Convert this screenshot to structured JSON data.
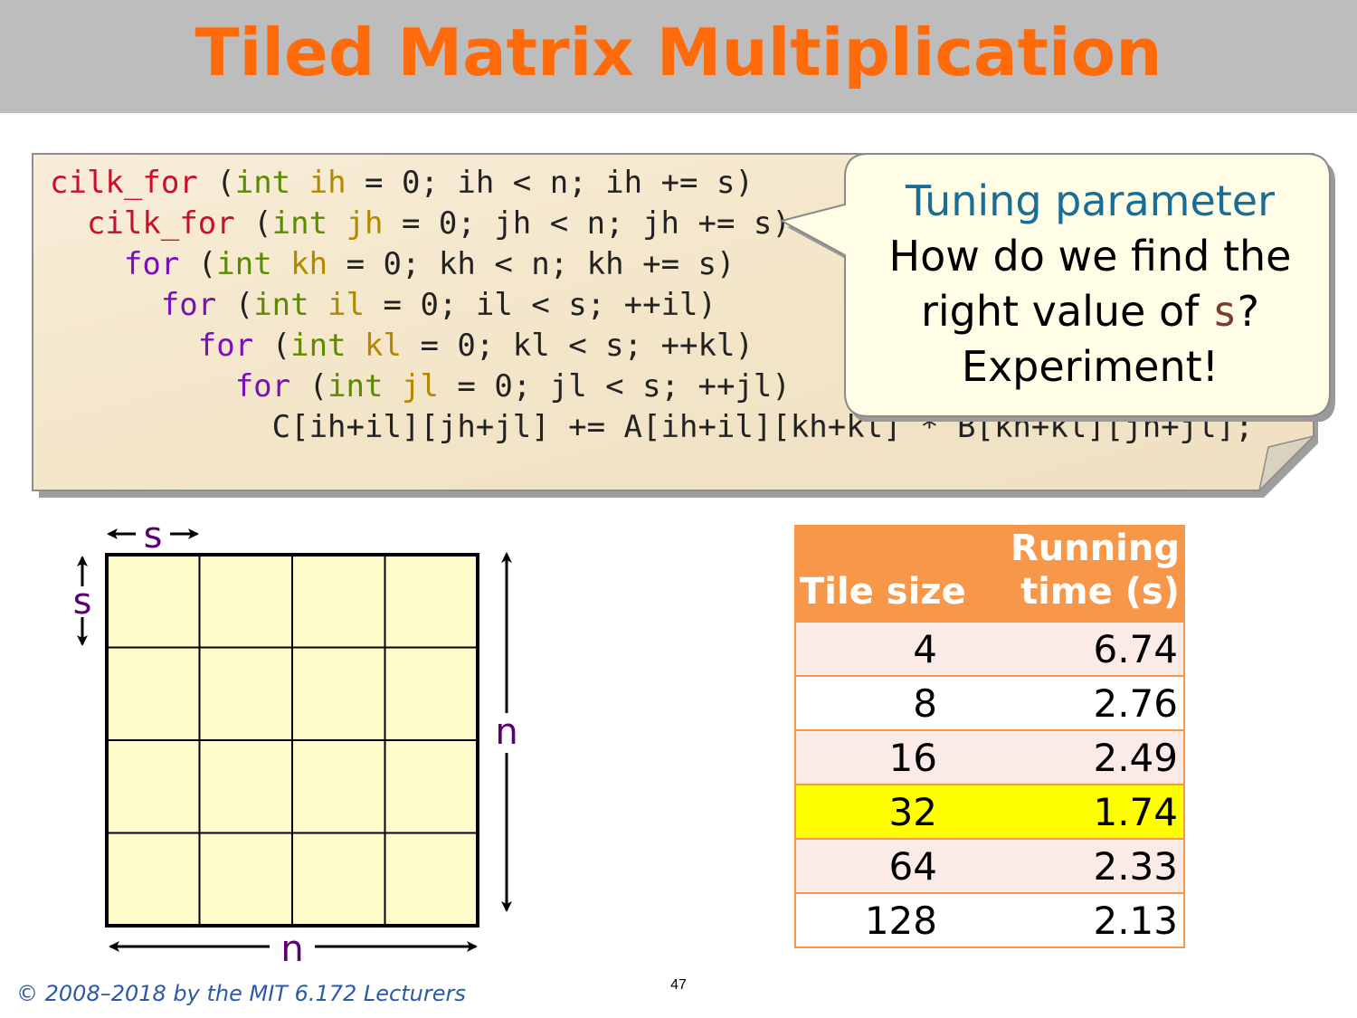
{
  "title": "Tiled Matrix Multiplication",
  "code": {
    "lines": [
      [
        {
          "t": "cilk_for",
          "c": "kw"
        },
        {
          "t": " (",
          "c": "pl"
        },
        {
          "t": "int",
          "c": "ty"
        },
        {
          "t": " ",
          "c": "pl"
        },
        {
          "t": "ih",
          "c": "va"
        },
        {
          "t": " = 0; ih < n; ih += s)",
          "c": "pl"
        }
      ],
      [
        {
          "t": "  cilk_for",
          "c": "kw"
        },
        {
          "t": " (",
          "c": "pl"
        },
        {
          "t": "int",
          "c": "ty"
        },
        {
          "t": " ",
          "c": "pl"
        },
        {
          "t": "jh",
          "c": "va"
        },
        {
          "t": " = 0; jh < n; jh += s)",
          "c": "pl"
        }
      ],
      [
        {
          "t": "    for",
          "c": "kw2"
        },
        {
          "t": " (",
          "c": "pl"
        },
        {
          "t": "int",
          "c": "ty"
        },
        {
          "t": " ",
          "c": "pl"
        },
        {
          "t": "kh",
          "c": "va"
        },
        {
          "t": " = 0; kh < n; kh += s)",
          "c": "pl"
        }
      ],
      [
        {
          "t": "      for",
          "c": "kw2"
        },
        {
          "t": " (",
          "c": "pl"
        },
        {
          "t": "int",
          "c": "ty"
        },
        {
          "t": " ",
          "c": "pl"
        },
        {
          "t": "il",
          "c": "va"
        },
        {
          "t": " = 0; il < s; ++il)",
          "c": "pl"
        }
      ],
      [
        {
          "t": "        for",
          "c": "kw2"
        },
        {
          "t": " (",
          "c": "pl"
        },
        {
          "t": "int",
          "c": "ty"
        },
        {
          "t": " ",
          "c": "pl"
        },
        {
          "t": "kl",
          "c": "va"
        },
        {
          "t": " = 0; kl < s; ++kl)",
          "c": "pl"
        }
      ],
      [
        {
          "t": "          for",
          "c": "kw2"
        },
        {
          "t": " (",
          "c": "pl"
        },
        {
          "t": "int",
          "c": "ty"
        },
        {
          "t": " ",
          "c": "pl"
        },
        {
          "t": "jl",
          "c": "va"
        },
        {
          "t": " = 0; jl < s; ++jl)",
          "c": "pl"
        }
      ],
      [
        {
          "t": "            C[ih+il][jh+jl] += A[ih+il][kh+kl] * B[kh+kl][jh+jl];",
          "c": "pl"
        }
      ]
    ]
  },
  "callout": {
    "heading": "Tuning parameter",
    "line1": "How do we find the",
    "line2_pre": "right value of ",
    "line2_var": "s",
    "line2_post": "?",
    "line3": "Experiment!"
  },
  "diagram": {
    "tile_label_h": "s",
    "tile_label_v": "s",
    "size_label_v": "n",
    "size_label_h": "n",
    "tiles_per_side": 4,
    "fill_color": "#fffccc"
  },
  "table": {
    "header_col1": "Tile size",
    "header_col2_line1": "Running",
    "header_col2_line2": "time (s)",
    "rows": [
      {
        "tile": "4",
        "time": "6.74",
        "highlight": false
      },
      {
        "tile": "8",
        "time": "2.76",
        "highlight": false
      },
      {
        "tile": "16",
        "time": "2.49",
        "highlight": false
      },
      {
        "tile": "32",
        "time": "1.74",
        "highlight": true
      },
      {
        "tile": "64",
        "time": "2.33",
        "highlight": false
      },
      {
        "tile": "128",
        "time": "2.13",
        "highlight": false
      }
    ],
    "header_color": "#f7974a",
    "highlight_color": "#ffff00"
  },
  "footer": {
    "copyright": "© 2008–2018 by the MIT 6.172 Lecturers",
    "page": "47"
  }
}
